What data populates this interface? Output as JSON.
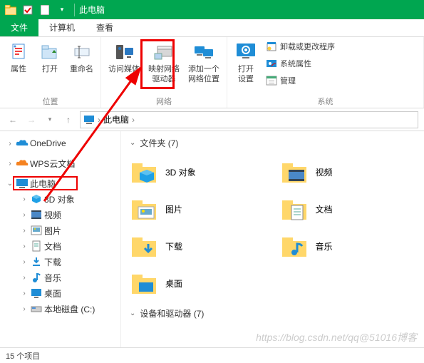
{
  "title": "此电脑",
  "tabs": {
    "file": "文件",
    "computer": "计算机",
    "view": "查看"
  },
  "ribbon": {
    "group_location": "位置",
    "group_network": "网络",
    "group_system": "系统",
    "props": "属性",
    "open": "打开",
    "rename": "重命名",
    "access_media": "访问媒体",
    "map_drive": "映射网络\n驱动器",
    "add_loc": "添加一个\n网络位置",
    "open_settings": "打开\n设置",
    "uninstall": "卸载或更改程序",
    "sysprops": "系统属性",
    "manage": "管理"
  },
  "addr": {
    "text": "此电脑",
    "sep": "›"
  },
  "nav": {
    "onedrive": "OneDrive",
    "wps": "WPS云文档",
    "this_pc": "此电脑",
    "obj3d": "3D 对象",
    "videos": "视频",
    "pictures": "图片",
    "docs": "文档",
    "downloads": "下载",
    "music": "音乐",
    "desktop": "桌面",
    "local": "本地磁盘 (C:)"
  },
  "content": {
    "folders_head": "文件夹 (7)",
    "devices_head": "设备和驱动器 (7)",
    "items": {
      "obj3d": "3D 对象",
      "videos": "视频",
      "pictures": "图片",
      "docs": "文档",
      "downloads": "下载",
      "music": "音乐",
      "desktop": "桌面"
    }
  },
  "status": "15 个项目",
  "watermark": "https://blog.csdn.net/qq@51016博客"
}
